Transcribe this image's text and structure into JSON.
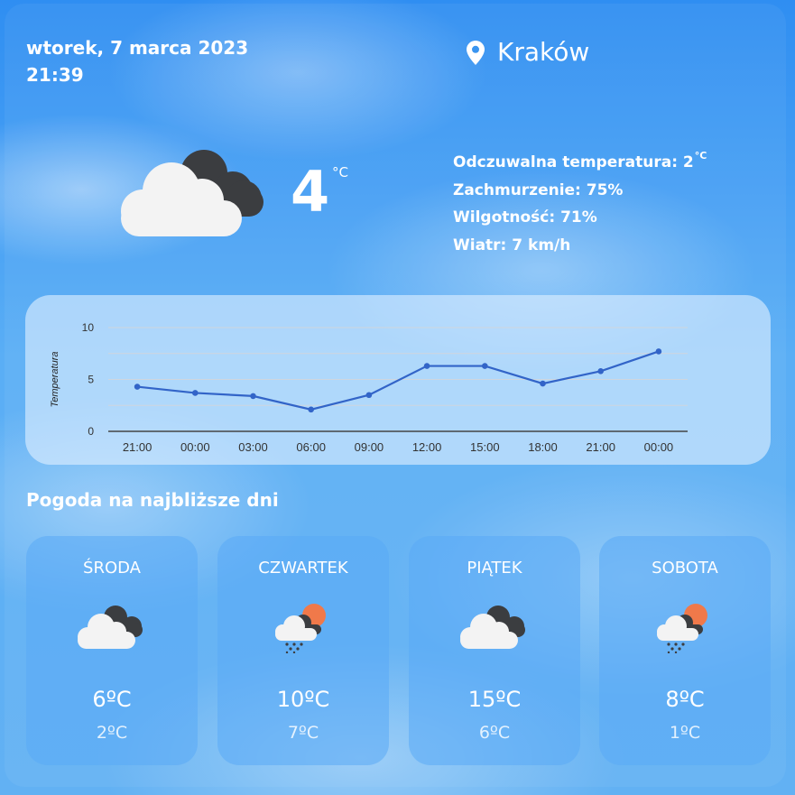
{
  "header": {
    "date": "wtorek, 7 marca 2023",
    "time": "21:39",
    "city": "Kraków"
  },
  "current": {
    "temperature": "4",
    "unit": "°C",
    "icon": "cloudy-icon",
    "details": {
      "feels_like_label": "Odczuwalna temperatura: 2",
      "feels_like_unit": "°C",
      "clouds": "Zachmurzenie: 75%",
      "humidity": "Wilgotność: 71%",
      "wind": "Wiatr: 7 km/h"
    }
  },
  "chart_data": {
    "type": "line",
    "ylabel": "Temperatura",
    "ylim": [
      0,
      10
    ],
    "yticks": [
      "0",
      "5",
      "10"
    ],
    "categories": [
      "21:00",
      "00:00",
      "03:00",
      "06:00",
      "09:00",
      "12:00",
      "15:00",
      "18:00",
      "21:00",
      "00:00"
    ],
    "series": [
      {
        "values": [
          4.3,
          3.7,
          3.4,
          2.1,
          3.5,
          6.3,
          6.3,
          4.6,
          5.8,
          7.7
        ]
      }
    ],
    "colors": {
      "line": "#3264c8"
    }
  },
  "forecast": {
    "title": "Pogoda na najbliższe dni",
    "days": [
      {
        "name": "ŚRODA",
        "max": "6ºC",
        "min": "2ºC",
        "icon": "cloudy-icon"
      },
      {
        "name": "CZWARTEK",
        "max": "10ºC",
        "min": "7ºC",
        "icon": "sun-rain-cloud-icon"
      },
      {
        "name": "PIĄTEK",
        "max": "15ºC",
        "min": "6ºC",
        "icon": "cloudy-icon"
      },
      {
        "name": "SOBOTA",
        "max": "8ºC",
        "min": "1ºC",
        "icon": "sun-rain-cloud-icon"
      }
    ]
  }
}
